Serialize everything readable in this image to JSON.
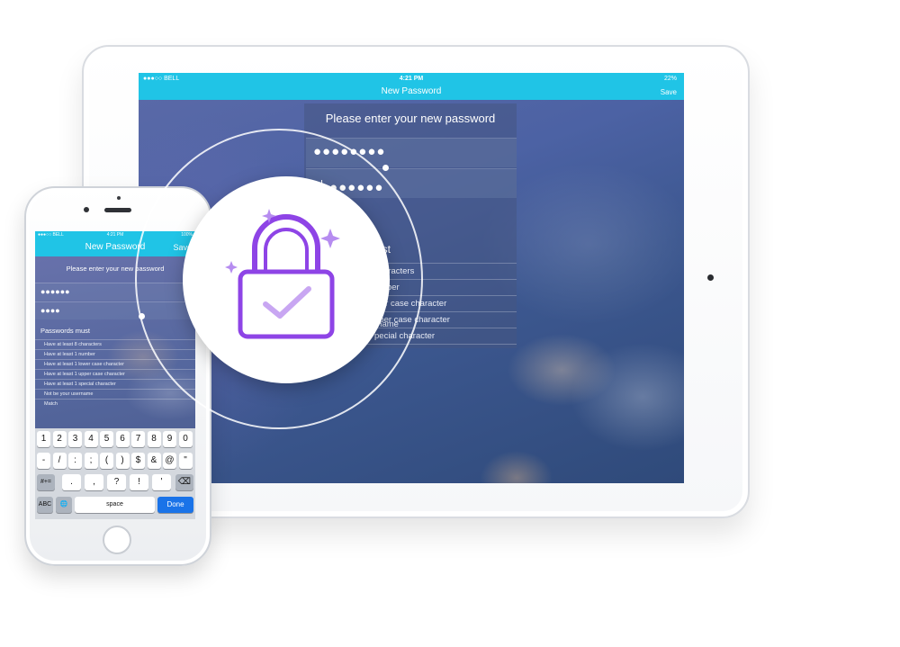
{
  "ipad": {
    "status": {
      "carrier": "●●●○○ BELL",
      "time": "4:21 PM",
      "battery": "22%"
    },
    "nav": {
      "title": "New Password",
      "save_label": "Save"
    },
    "prompt": "Please enter your new password",
    "password_field": "●●●●●●●●",
    "confirm_field": "●●●●●●●",
    "rules_title_partial": "must",
    "rules_partial": [
      "characters",
      "mber",
      "wer case character",
      "pper case character",
      "pecial character",
      "rname"
    ]
  },
  "iphone": {
    "status": {
      "carrier": "●●●○○ BELL",
      "time": "4:21 PM",
      "battery": "100%"
    },
    "nav": {
      "title": "New Password",
      "save_label": "Save"
    },
    "prompt": "Please enter your new password",
    "password_field": "●●●●●●",
    "confirm_field": "●●●●",
    "rules_title": "Passwords must",
    "rules": [
      "Have at least 8 characters",
      "Have at least 1 number",
      "Have at least 1 lower case character",
      "Have at least 1 upper case character",
      "Have at least 1 special character",
      "Not be your username",
      "Match"
    ],
    "keyboard": {
      "row1": [
        "1",
        "2",
        "3",
        "4",
        "5",
        "6",
        "7",
        "8",
        "9",
        "0"
      ],
      "row2": [
        "-",
        "/",
        ":",
        ";",
        "(",
        ")",
        "$",
        "&",
        "@",
        "\""
      ],
      "row3_left": "#+=",
      "row3": [
        ".",
        ",",
        "?",
        "!",
        "'"
      ],
      "row3_right": "⌫",
      "abc": "ABC",
      "globe": "🌐",
      "space": "space",
      "done": "Done"
    }
  },
  "colors": {
    "accent": "#20c4e6",
    "lock": "#8e44e6",
    "done_key": "#1a73e8"
  },
  "icons": {
    "lock": "lock-check-icon",
    "sparkle": "sparkle-icon"
  }
}
